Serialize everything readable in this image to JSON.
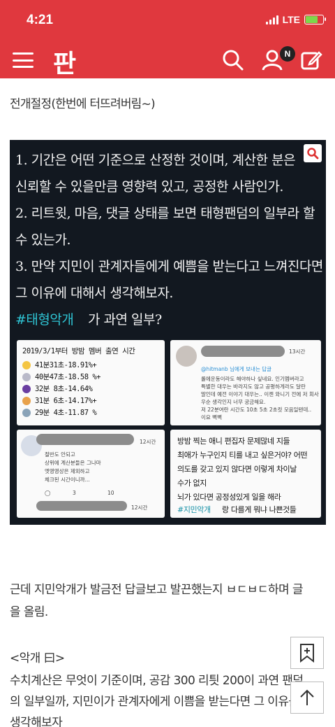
{
  "status_bar": {
    "time": "4:21",
    "network": "LTE",
    "battery_level": 0.7,
    "accent": "#e0383e"
  },
  "header": {
    "logo": "판",
    "notification_badge": "N",
    "icons": [
      "menu-icon",
      "search-icon",
      "user-icon",
      "edit-icon"
    ]
  },
  "post": {
    "intro": "전개절정(한번에 터뜨려버림~)",
    "image": {
      "lines": [
        "1. 기간은 어떤 기준으로 산정한 것이며, 계산한 분은",
        "신뢰할 수 있을만큼 영향력 있고, 공정한 사람인가.",
        "2. 리트윗, 마음, 댓글 상태를 보면 태형팬덤의 일부라 할",
        "수 있는가.",
        "3. 만약 지민이 관계자들에게 예쁨을 받는다고 느껴진다면",
        "그 이유에 대해서 생각해보자."
      ],
      "hashtag": "#태형악개",
      "hashtag_suffix": "가 과연 일부?",
      "panel1": {
        "title": "2019/3/1부터 방밤 멤버 출연 시간",
        "rows": [
          "41분31초-18.91%+",
          "40분47초-18.58 %+",
          "32분 8초-14.64%",
          "31분 6초-14.17%+",
          "29분 4초-11.87 %"
        ]
      },
      "panel2": {
        "time": "13시간",
        "handle": "@hitmanb 님에게 보내는 답글",
        "lines": [
          "롤에운동이라도 해야하나 싶네요. 인기멤버라고",
          "특별한 대우는 바라지도 않고 공평하게라도 달란",
          "말인데 예전 이야기 대우는.. 이젠 와니기 전에 저 회사",
          "우순 생각인지 너무 궁금해요.",
          "저 22분여란 시간도 10초 5초 2초컷 모음일텐데..",
          "이요 뻑뻑"
        ]
      },
      "panel3": {
        "time": "12시간",
        "lines": [
          "절반도 안되고",
          "상위에 계산분들은 그나마",
          "엣영영상은 제외하고",
          "체크된 시간이니까..."
        ],
        "count_rt": "3",
        "count_like": "10",
        "time2": "12시간"
      },
      "panel4": {
        "lines": [
          "방밤 찍는 애니 편집자 문제많네 지들",
          "최애가 누구인지 티를 내고 싶은거야? 어떤",
          "의도를 갖고 있지 않다면 이렇게 차이날",
          "수가 없지",
          "뇌가 있다면 공정성있게 일을 해라"
        ],
        "hashtag": "#지민악개",
        "hashtag_suffix": "랑 다를게 뭐냐 나쁜것들"
      }
    },
    "para1_line1": "근데 지민악개가 발금전 답글보고 발끈했는지 ㅂㄷㅂㄷ하며 글",
    "para1_line2": "을 올림.",
    "para2_line1": "<악개 曰>",
    "para2_line2": "수치계산은 무엇이 기준이며, 공감 300 리틧 200이 과연 팬덤",
    "para2_line3": "의 일부일까, 지민이가 관계자에게 이쁨을 받는다면 그 이유를",
    "para2_line4": "생각해보자"
  }
}
